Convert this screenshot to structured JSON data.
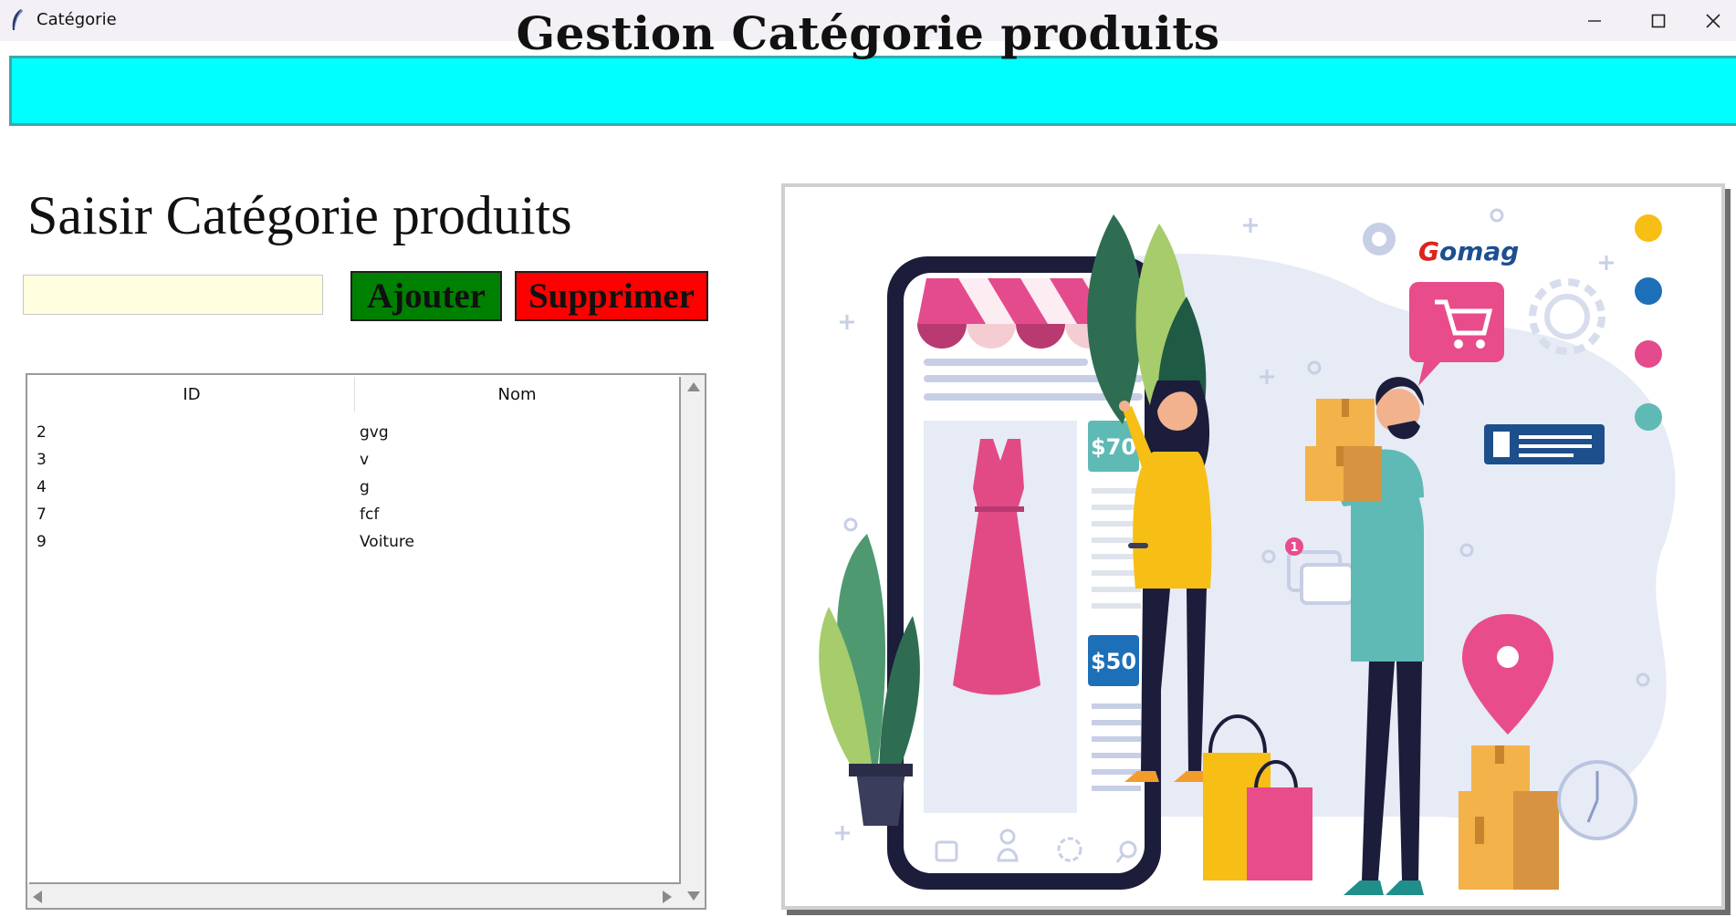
{
  "window": {
    "title": "Catégorie",
    "controls": {
      "minimize": "minimize-icon",
      "maximize": "maximize-icon",
      "close": "close-icon"
    }
  },
  "header": {
    "title": "Gestion Catégorie produits",
    "background": "#00ffff"
  },
  "form": {
    "heading": "Saisir Catégorie produits",
    "input_value": "",
    "input_background": "#fffedf",
    "add_label": "Ajouter",
    "add_color": "#008000",
    "delete_label": "Supprimer",
    "delete_color": "#ff0000"
  },
  "table": {
    "columns": [
      "ID",
      "Nom"
    ],
    "rows": [
      {
        "id": "2",
        "nom": "gvg"
      },
      {
        "id": "3",
        "nom": "v"
      },
      {
        "id": "4",
        "nom": "g"
      },
      {
        "id": "7",
        "nom": "fcf"
      },
      {
        "id": "9",
        "nom": "Voiture"
      }
    ]
  },
  "illustration": {
    "brand": "Gomag",
    "price_tag_1": "$70",
    "price_tag_2": "$50",
    "notification_count": "1"
  }
}
